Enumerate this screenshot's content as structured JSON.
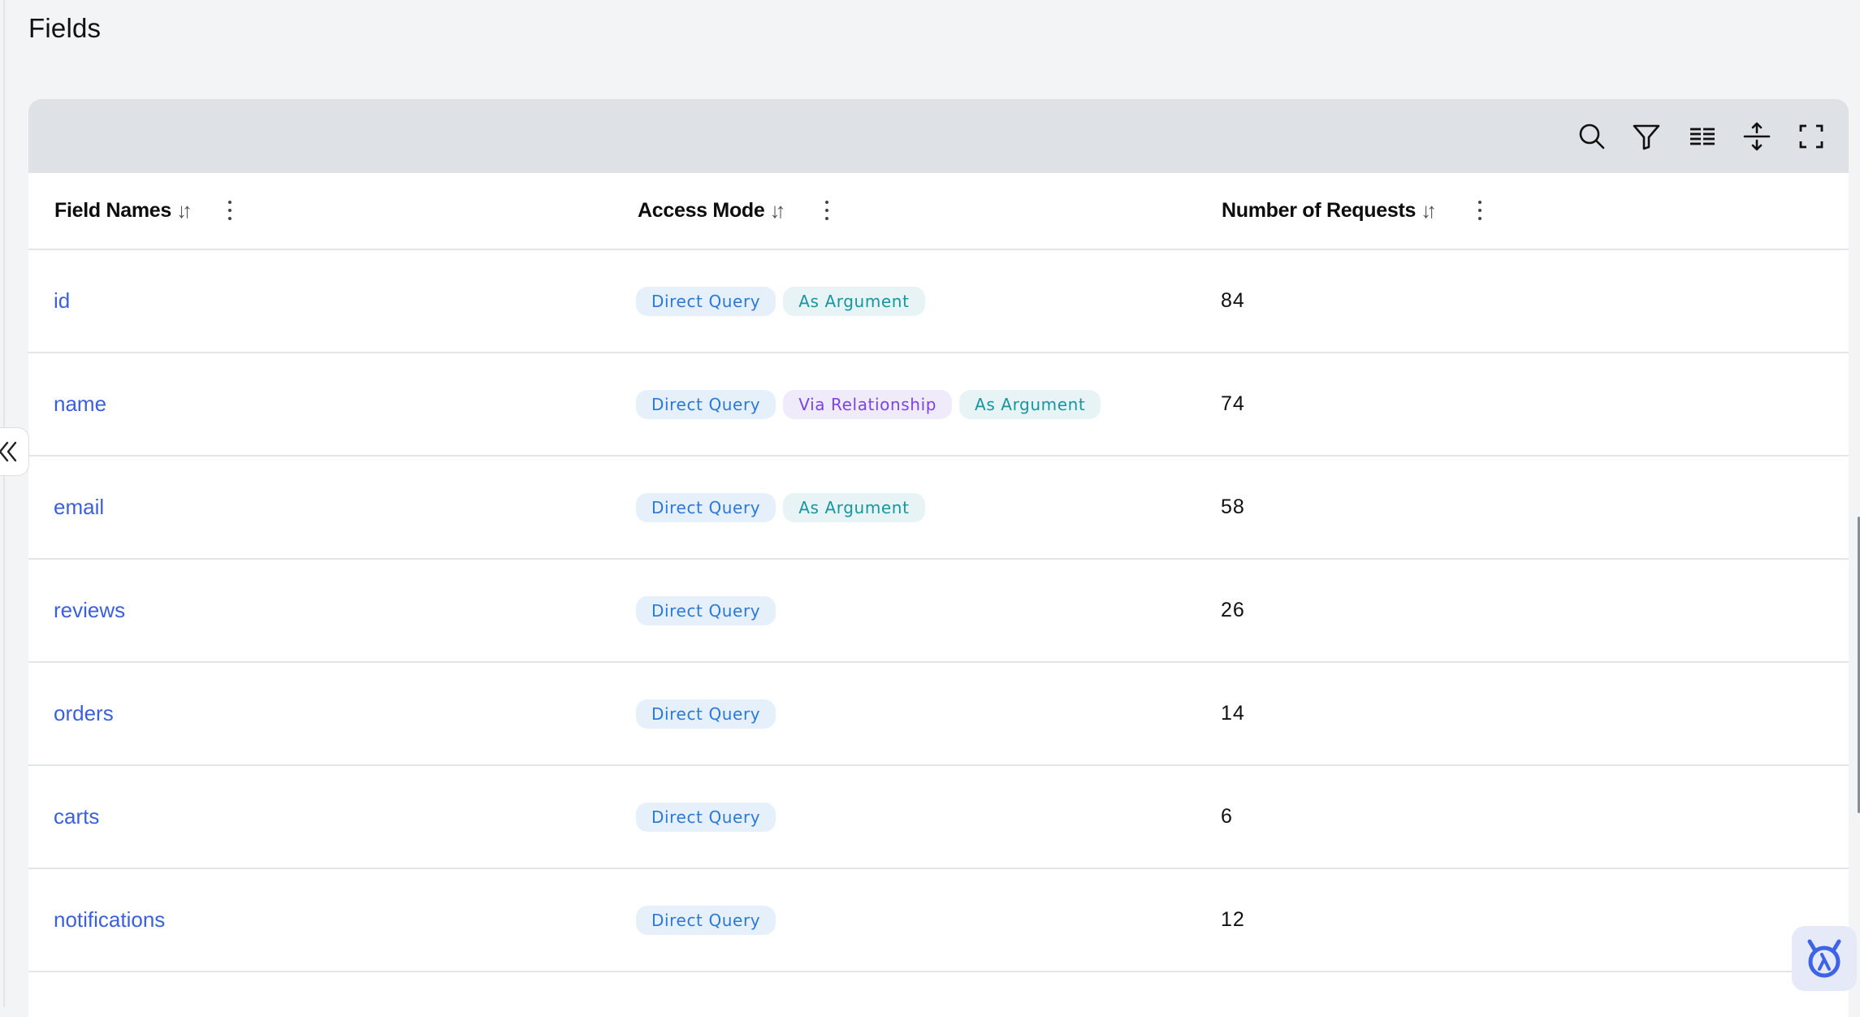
{
  "page": {
    "title": "Fields"
  },
  "toolbar": {
    "icons": [
      "search-icon",
      "filter-icon",
      "columns-icon",
      "density-icon",
      "fullscreen-icon"
    ]
  },
  "table": {
    "columns": [
      {
        "label": "Field Names",
        "sort_icon": "↓↑"
      },
      {
        "label": "Access Mode",
        "sort_icon": "↓↑"
      },
      {
        "label": "Number of Requests",
        "sort_icon": "↓↑"
      }
    ],
    "rows": [
      {
        "name": "id",
        "modes": [
          "Direct Query",
          "As Argument"
        ],
        "requests": "84"
      },
      {
        "name": "name",
        "modes": [
          "Direct Query",
          "Via Relationship",
          "As Argument"
        ],
        "requests": "74"
      },
      {
        "name": "email",
        "modes": [
          "Direct Query",
          "As Argument"
        ],
        "requests": "58"
      },
      {
        "name": "reviews",
        "modes": [
          "Direct Query"
        ],
        "requests": "26"
      },
      {
        "name": "orders",
        "modes": [
          "Direct Query"
        ],
        "requests": "14"
      },
      {
        "name": "carts",
        "modes": [
          "Direct Query"
        ],
        "requests": "6"
      },
      {
        "name": "notifications",
        "modes": [
          "Direct Query"
        ],
        "requests": "12"
      }
    ]
  },
  "badge_colors": {
    "Direct Query": {
      "bg": "#e6f0fb",
      "fg": "#2b79d6"
    },
    "Via Relationship": {
      "bg": "#f0ebfb",
      "fg": "#7a45e0"
    },
    "As Argument": {
      "bg": "#e7f3f5",
      "fg": "#16969e"
    }
  },
  "colors": {
    "link": "#3b5fe0",
    "toolbar_bg": "#dee1e6",
    "page_bg": "#f3f4f6",
    "help_widget_accent": "#3d63e6"
  },
  "widgets": {
    "collapse_icon": "double-chevron-left-icon",
    "help_icon": "hasura-lambda-icon"
  }
}
